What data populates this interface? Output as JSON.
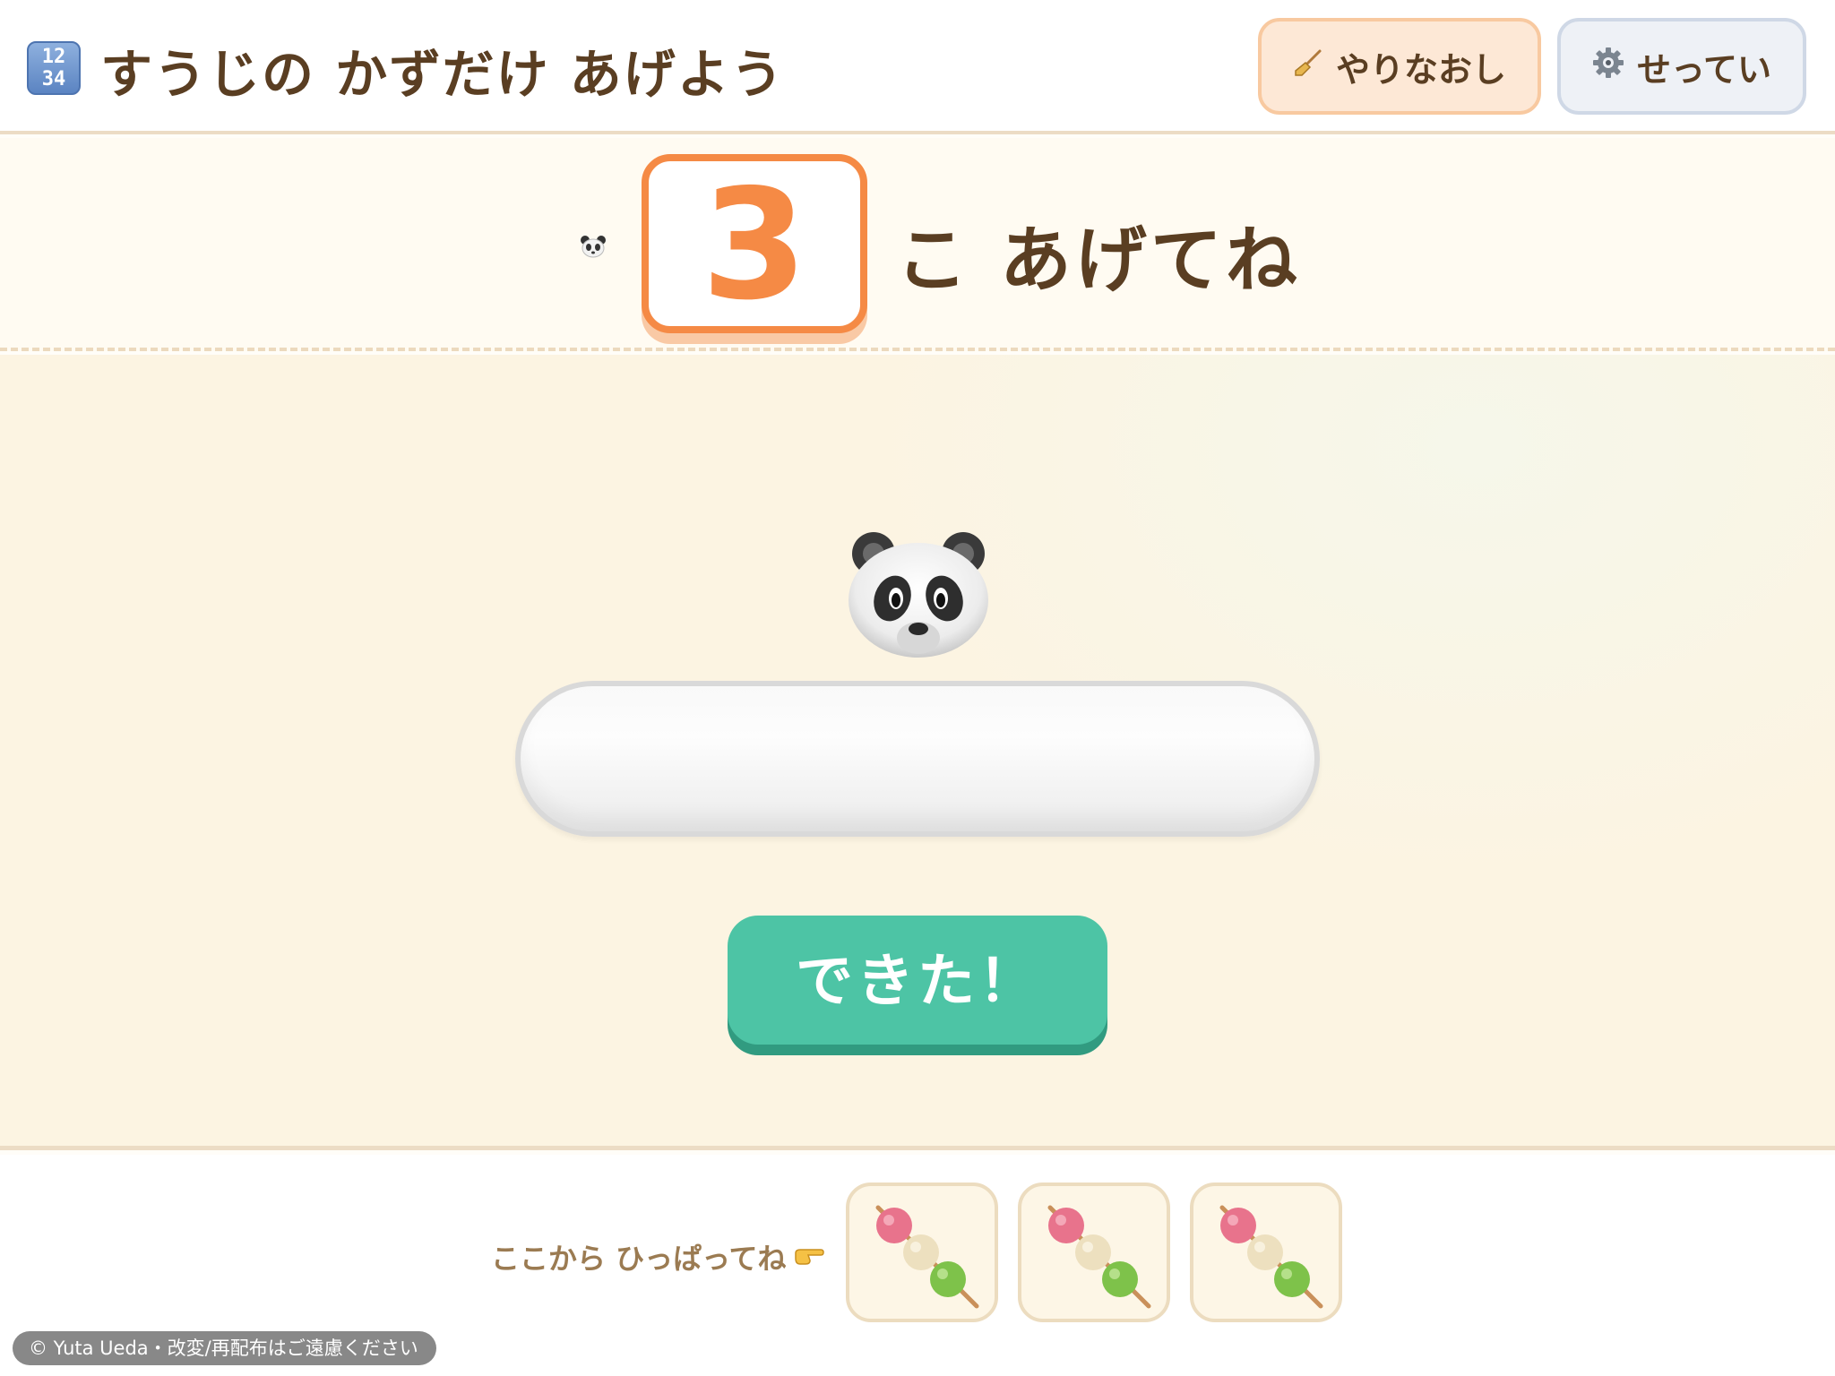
{
  "header": {
    "app_icon_text": "1234",
    "title": "すうじの かずだけ あげよう",
    "redo_label": "やりなおし",
    "settings_label": "せってい"
  },
  "prompt": {
    "target_number": "3",
    "suffix": "こ あげてね"
  },
  "play": {
    "done_label": "できた！",
    "plate_count": 0
  },
  "tray": {
    "hint": "ここから ひっぱってね",
    "items": [
      {
        "icon": "dango-icon"
      },
      {
        "icon": "dango-icon"
      },
      {
        "icon": "dango-icon"
      }
    ]
  },
  "footer": {
    "credit": "© Yuta Ueda・改変/再配布はご遠慮ください"
  },
  "colors": {
    "accent_orange": "#f58a45",
    "done_green": "#4dc4a5",
    "text_brown": "#5a3e22"
  }
}
